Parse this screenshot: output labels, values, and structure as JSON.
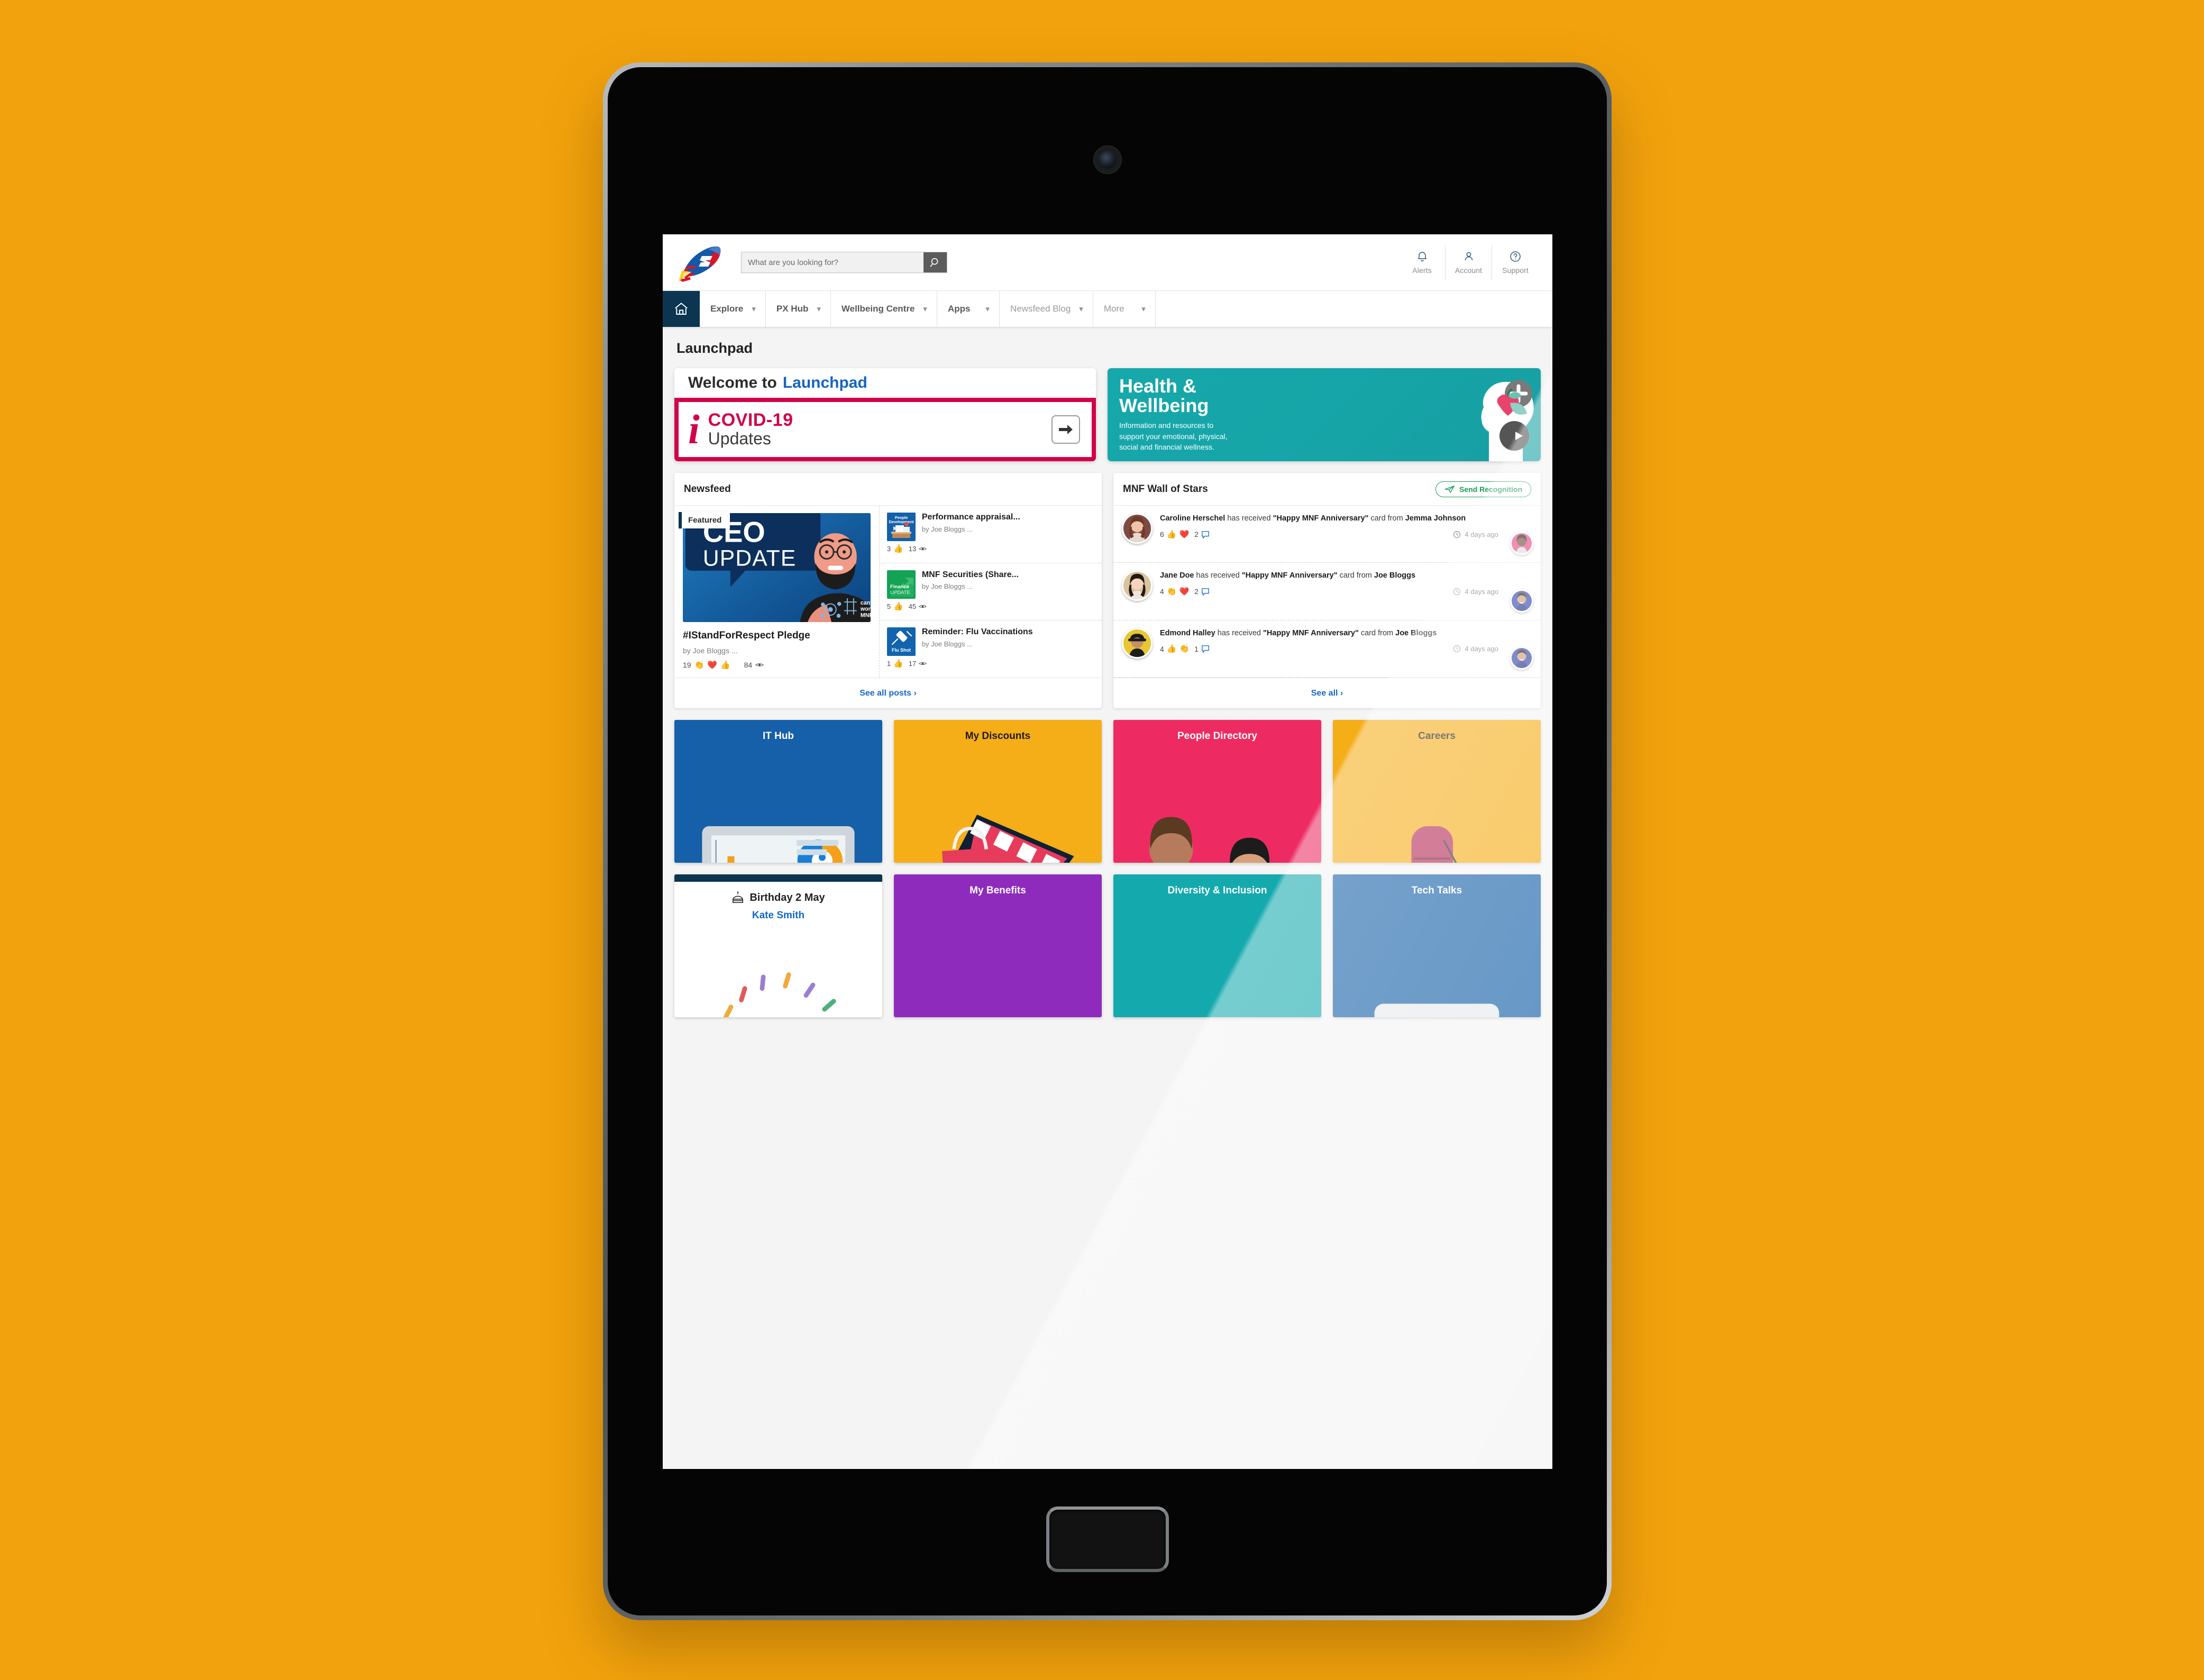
{
  "background_color": "#f2a20c",
  "header": {
    "logo_name": "rocket-logo",
    "search": {
      "placeholder": "What are you looking for?",
      "value": ""
    },
    "actions": [
      {
        "label": "Alerts",
        "icon": "bell-icon"
      },
      {
        "label": "Account",
        "icon": "user-icon"
      },
      {
        "label": "Support",
        "icon": "question-circle-icon"
      }
    ]
  },
  "nav": {
    "home_icon": "home-icon",
    "items": [
      {
        "label": "Explore",
        "muted": false
      },
      {
        "label": "PX Hub",
        "muted": false
      },
      {
        "label": "Wellbeing Centre",
        "muted": false
      },
      {
        "label": "Apps",
        "muted": false
      },
      {
        "label": "Newsfeed Blog",
        "muted": true
      },
      {
        "label": "More",
        "muted": true
      }
    ]
  },
  "page": {
    "title": "Launchpad"
  },
  "hero": {
    "welcome": {
      "line_plain": "Welcome to",
      "line_accent": "Launchpad",
      "accent_color": "#1565c0",
      "covid_title": "COVID-19",
      "covid_sub": "Updates",
      "covid_color": "#d0004b",
      "arrow_icon": "arrow-right-icon"
    },
    "health": {
      "title_line1": "Health &",
      "title_line2": "Wellbeing",
      "body": "Information and resources to support your emotional, physical, social and financial wellness.",
      "bg_color": "#17a8ab",
      "arrow_icon": "arrow-right-icon"
    }
  },
  "newsfeed": {
    "heading": "Newsfeed",
    "featured_badge": "Featured",
    "featured": {
      "image_caption_1": "CEO",
      "image_caption_2": "UPDATE",
      "shirt_text": "cant stop wont stop MNF",
      "title": "#IStandForRespect Pledge",
      "by": "by Joe Bloggs ...",
      "reactions": "19",
      "reaction_emojis": [
        "👏",
        "❤️",
        "👍"
      ],
      "views": "84"
    },
    "items": [
      {
        "thumb_label_1": "People",
        "thumb_label_2": "Development",
        "thumb_color": "#1561a9",
        "title": "Performance appraisal...",
        "by": "by Joe Bloggs ...",
        "reactions": "3",
        "reaction_emojis": [
          "👍"
        ],
        "views": "13"
      },
      {
        "thumb_label_1": "Finance",
        "thumb_label_2": "UPDATE",
        "thumb_color": "#14a254",
        "title": "MNF Securities (Share...",
        "by": "by Joe Bloggs ...",
        "reactions": "5",
        "reaction_emojis": [
          "👍"
        ],
        "views": "45"
      },
      {
        "thumb_label_1": "Flu Shot",
        "thumb_label_2": "",
        "thumb_color": "#1164ad",
        "title": "Reminder: Flu Vaccinations",
        "by": "by Joe Bloggs ...",
        "reactions": "1",
        "reaction_emojis": [
          "👍"
        ],
        "views": "17"
      }
    ],
    "footer_link": "See all posts ›"
  },
  "wall_of_stars": {
    "heading": "MNF Wall of Stars",
    "send_button": "Send Recognition",
    "send_button_color": "#1a9b56",
    "send_icon": "send-paper-plane-icon",
    "items": [
      {
        "recipient": "Caroline Herschel",
        "mid": " has received ",
        "card": "\"Happy MNF Anniversary\"",
        "tail": " card from ",
        "sender": "Jemma Johnson",
        "reactions": "6",
        "reaction_emojis": [
          "👍",
          "❤️"
        ],
        "comments": "2",
        "time": "4 days ago",
        "avatar_bg": "#8a5a4a",
        "sender_avatar_bg": "#e8407e"
      },
      {
        "recipient": "Jane Doe",
        "mid": "  has received ",
        "card": "\"Happy MNF Anniversary\"",
        "tail": " card from ",
        "sender": "Joe Bloggs",
        "reactions": "4",
        "reaction_emojis": [
          "👏",
          "❤️"
        ],
        "comments": "2",
        "time": "4 days ago",
        "avatar_bg": "#d8c39c",
        "sender_avatar_bg": "#2b3fa8"
      },
      {
        "recipient": "Edmond Halley",
        "mid": " has received ",
        "card": "\"Happy MNF Anniversary\"",
        "tail": " card from ",
        "sender": "Joe Bloggs",
        "reactions": "4",
        "reaction_emojis": [
          "👍",
          "👏"
        ],
        "comments": "1",
        "time": "4 days ago",
        "avatar_bg": "#e8c732",
        "sender_avatar_bg": "#2b3fa8"
      }
    ],
    "footer_link": "See all ›"
  },
  "tiles_row_1": [
    {
      "label": "IT Hub",
      "color": "#1560a8",
      "art": "monitor-dashboard-art"
    },
    {
      "label": "My Discounts",
      "color": "#f5ad18",
      "art": "laptop-shopping-art"
    },
    {
      "label": "People Directory",
      "color": "#ed2b62",
      "art": "people-desk-art"
    },
    {
      "label": "Careers",
      "color": "#f5ad18",
      "art": "vacant-chair-art"
    }
  ],
  "tiles_row_2": [
    {
      "label": "Birthday 2 May",
      "name": "Kate Smith",
      "color": "#ffffff",
      "art": "birthday-cake-art",
      "type": "birthday"
    },
    {
      "label": "My Benefits",
      "color": "#8e2bbd",
      "art": "two-people-art"
    },
    {
      "label": "Diversity & Inclusion",
      "color": "#14a9ad",
      "art": "hands-heart-art"
    },
    {
      "label": "Tech Talks",
      "color": "#1560a8",
      "art": "tablet-art"
    }
  ]
}
